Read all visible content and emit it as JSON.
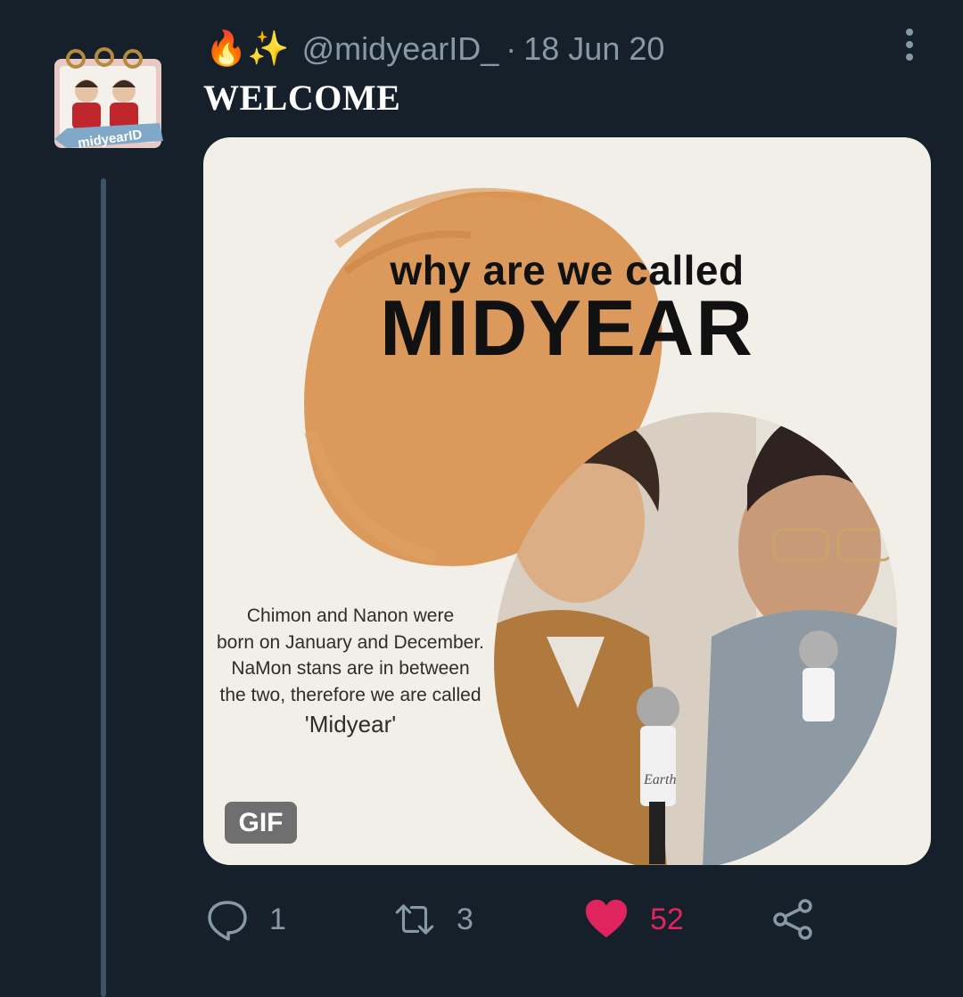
{
  "tweet": {
    "emojis": "🔥✨",
    "handle": "@midyearID_",
    "separator": "·",
    "date": "18 Jun 20",
    "text": "WELCOME",
    "avatar_label": "midyearID"
  },
  "media": {
    "title_line1": "why are we called",
    "title_line2": "MIDYEAR",
    "body_lines": [
      "Chimon and Nanon were",
      "born on January and December.",
      "NaMon stans are in between",
      "the two, therefore we are called"
    ],
    "quote": "'Midyear'",
    "badge": "GIF",
    "mic_label": "Earth"
  },
  "actions": {
    "reply_count": "1",
    "retweet_count": "3",
    "like_count": "52"
  },
  "colors": {
    "background": "#15202b",
    "secondary_text": "#8899a6",
    "like": "#e0245e",
    "brush": "#d9924f"
  }
}
